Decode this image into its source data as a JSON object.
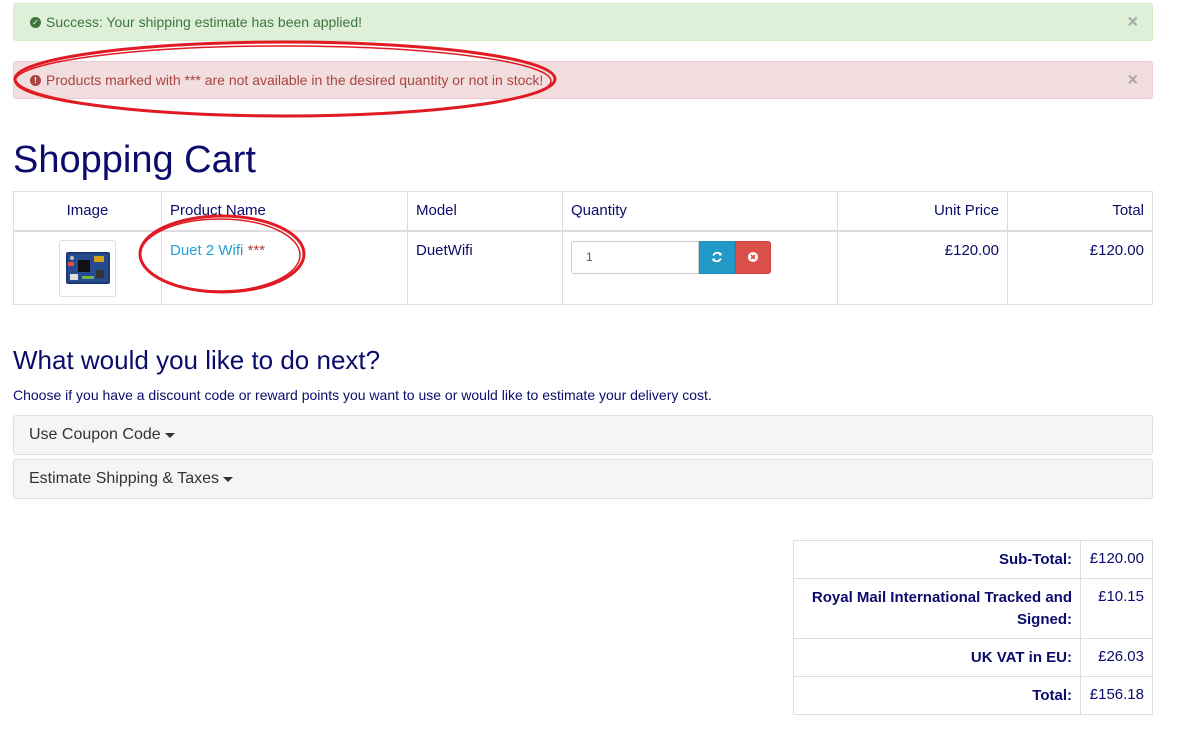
{
  "alerts": {
    "success": {
      "text": "Success: Your shipping estimate has been applied!",
      "icon": "check-circle-icon",
      "close": "×"
    },
    "danger": {
      "text": "Products marked with *** are not available in the desired quantity or not in stock!",
      "icon": "exclamation-circle-icon",
      "close": "×"
    }
  },
  "page_title": "Shopping Cart",
  "cart": {
    "headers": {
      "image": "Image",
      "product_name": "Product Name",
      "model": "Model",
      "quantity": "Quantity",
      "unit_price": "Unit Price",
      "total": "Total"
    },
    "items": [
      {
        "name": "Duet 2 Wifi",
        "stock_marker": "***",
        "model": "DuetWifi",
        "quantity": "1",
        "unit_price": "£120.00",
        "total": "£120.00"
      }
    ]
  },
  "next": {
    "heading": "What would you like to do next?",
    "intro": "Choose if you have a discount code or reward points you want to use or would like to estimate your delivery cost.",
    "coupon_label": "Use Coupon Code",
    "shipping_label": "Estimate Shipping & Taxes"
  },
  "totals": [
    {
      "label": "Sub-Total:",
      "value": "£120.00"
    },
    {
      "label": "Royal Mail International Tracked and Signed:",
      "value": "£10.15"
    },
    {
      "label": "UK VAT in EU:",
      "value": "£26.03"
    },
    {
      "label": "Total:",
      "value": "£156.18"
    }
  ],
  "colors": {
    "text": "#0b0b6b",
    "link": "#23a1d1",
    "success_bg": "#dff0d8",
    "danger_bg": "#f2dede",
    "annotation": "#e01b24"
  }
}
